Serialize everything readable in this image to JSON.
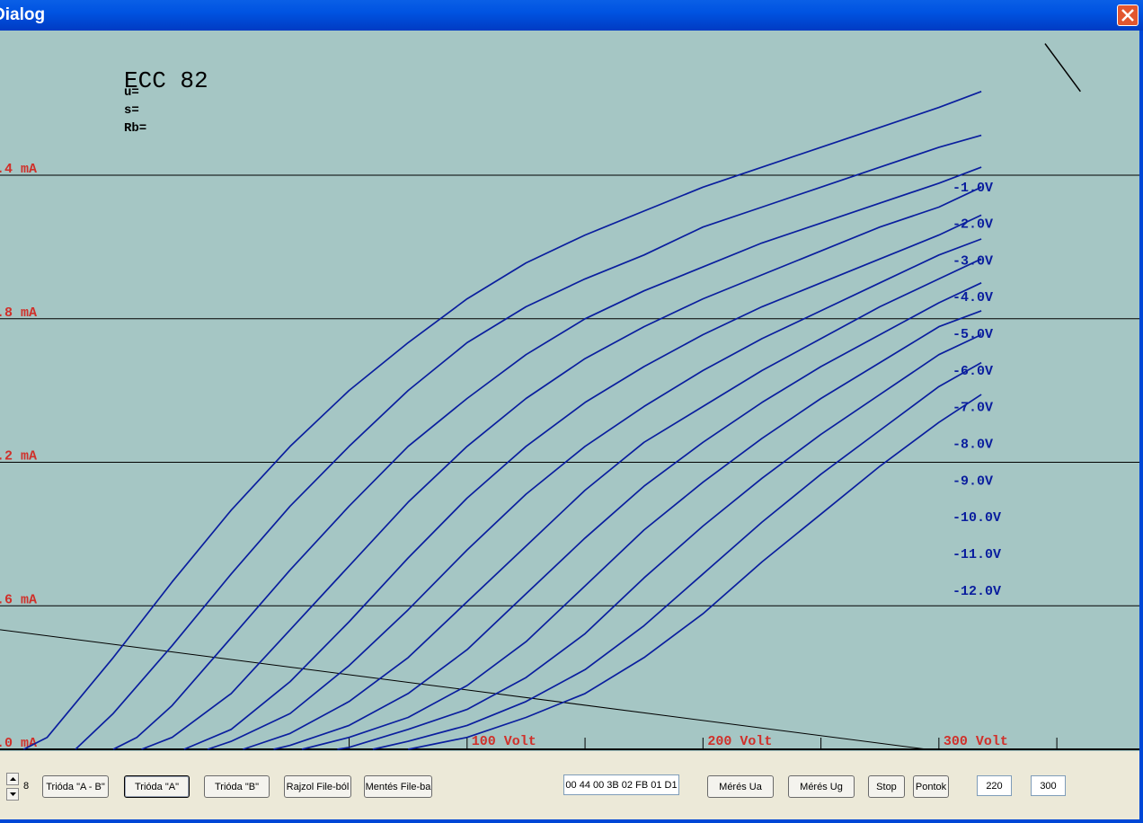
{
  "window": {
    "title": "Dialog",
    "close_icon": "close-icon",
    "accent": "#0053E1",
    "close_color": "#E2562F"
  },
  "plot": {
    "tube_name": "ECC 82",
    "params": [
      "u=",
      "s=",
      "Rb="
    ],
    "background": "#A5C6C4",
    "curve_color": "#0A1E9E",
    "axis_label_color": "#D0302A"
  },
  "chart_data": {
    "type": "line",
    "xlim": [
      -98,
      385
    ],
    "ylim": [
      0,
      14.4
    ],
    "x_tick_labels": [
      "100 Volt",
      "200 Volt",
      "300 Volt"
    ],
    "x_ticks": [
      50,
      100,
      150,
      200,
      250,
      300,
      350
    ],
    "y_tick_labels": [
      ".0 mA",
      ".6 mA",
      ".2 mA",
      ".8 mA",
      ".4 mA"
    ],
    "y_gridlines": [
      3.6,
      7.2,
      10.8,
      14.4
    ],
    "load_line": {
      "x": [
        -98,
        295
      ],
      "y": [
        3.0,
        0
      ]
    },
    "annotation_line": {
      "x": [
        345,
        360
      ],
      "y": [
        17.7,
        16.5
      ]
    },
    "series_labels": [
      "-1.0V",
      "-2.0V",
      "-3.0V",
      "-4.0V",
      "-5.0V",
      "-6.0V",
      "-7.0V",
      "-8.0V",
      "-9.0V",
      "-10.0V",
      "-11.0V",
      "-12.0V"
    ],
    "series": [
      {
        "name": "-1.0V",
        "x": [
          -88,
          -78,
          -50,
          -25,
          0,
          25,
          50,
          75,
          100,
          125,
          150,
          175,
          200,
          225,
          250,
          275,
          300,
          318
        ],
        "y": [
          0,
          0.3,
          2.3,
          4.2,
          6.0,
          7.6,
          9.0,
          10.2,
          11.3,
          12.2,
          12.9,
          13.5,
          14.1,
          14.6,
          15.1,
          15.6,
          16.1,
          16.5
        ]
      },
      {
        "name": "-2.0V",
        "x": [
          -66,
          -50,
          -25,
          0,
          25,
          50,
          75,
          100,
          125,
          150,
          175,
          200,
          225,
          250,
          275,
          300,
          318
        ],
        "y": [
          0,
          0.9,
          2.6,
          4.4,
          6.1,
          7.6,
          9.0,
          10.2,
          11.1,
          11.8,
          12.4,
          13.1,
          13.6,
          14.1,
          14.6,
          15.1,
          15.4
        ]
      },
      {
        "name": "-3.0V",
        "x": [
          -50,
          -40,
          -25,
          0,
          25,
          50,
          75,
          100,
          125,
          150,
          175,
          200,
          225,
          250,
          275,
          300,
          318
        ],
        "y": [
          0,
          0.3,
          1.1,
          2.8,
          4.5,
          6.1,
          7.6,
          8.8,
          9.9,
          10.8,
          11.5,
          12.1,
          12.7,
          13.2,
          13.7,
          14.2,
          14.6
        ]
      },
      {
        "name": "-4.0V",
        "x": [
          -38,
          -25,
          0,
          25,
          50,
          75,
          100,
          125,
          150,
          175,
          200,
          225,
          250,
          275,
          300,
          318
        ],
        "y": [
          0,
          0.3,
          1.4,
          3.0,
          4.6,
          6.2,
          7.6,
          8.8,
          9.8,
          10.6,
          11.3,
          11.9,
          12.5,
          13.1,
          13.6,
          14.1
        ]
      },
      {
        "name": "-5.0V",
        "x": [
          -20,
          0,
          25,
          50,
          75,
          100,
          125,
          150,
          175,
          200,
          225,
          250,
          275,
          300,
          318
        ],
        "y": [
          0,
          0.5,
          1.7,
          3.2,
          4.8,
          6.3,
          7.6,
          8.7,
          9.6,
          10.4,
          11.1,
          11.7,
          12.3,
          12.9,
          13.4
        ]
      },
      {
        "name": "-6.0V",
        "x": [
          -10,
          0,
          25,
          50,
          75,
          100,
          125,
          150,
          175,
          200,
          225,
          250,
          275,
          300,
          318
        ],
        "y": [
          0,
          0.2,
          0.9,
          2.1,
          3.5,
          5.0,
          6.4,
          7.6,
          8.6,
          9.5,
          10.3,
          11.0,
          11.7,
          12.4,
          12.8
        ]
      },
      {
        "name": "-7.0V",
        "x": [
          5,
          25,
          50,
          75,
          100,
          125,
          150,
          175,
          200,
          225,
          250,
          275,
          300,
          318
        ],
        "y": [
          0,
          0.4,
          1.2,
          2.3,
          3.7,
          5.1,
          6.5,
          7.7,
          8.6,
          9.5,
          10.3,
          11.1,
          11.8,
          12.3
        ]
      },
      {
        "name": "-8.0V",
        "x": [
          18,
          25,
          50,
          75,
          100,
          125,
          150,
          175,
          200,
          225,
          250,
          275,
          300,
          318
        ],
        "y": [
          0,
          0.1,
          0.6,
          1.4,
          2.5,
          3.9,
          5.3,
          6.6,
          7.7,
          8.7,
          9.6,
          10.4,
          11.2,
          11.7
        ]
      },
      {
        "name": "-9.0V",
        "x": [
          30,
          50,
          75,
          100,
          125,
          150,
          175,
          200,
          225,
          250,
          275,
          300,
          318
        ],
        "y": [
          0,
          0.3,
          0.8,
          1.6,
          2.7,
          4.1,
          5.5,
          6.7,
          7.8,
          8.8,
          9.7,
          10.6,
          11.0
        ]
      },
      {
        "name": "-10.0V",
        "x": [
          45,
          50,
          75,
          100,
          125,
          150,
          175,
          200,
          225,
          250,
          275,
          300,
          318
        ],
        "y": [
          0,
          0.05,
          0.5,
          1.0,
          1.8,
          2.9,
          4.3,
          5.6,
          6.8,
          7.9,
          8.9,
          9.9,
          10.4
        ]
      },
      {
        "name": "-11.0V",
        "x": [
          60,
          75,
          100,
          125,
          150,
          175,
          200,
          225,
          250,
          275,
          300,
          318
        ],
        "y": [
          0,
          0.2,
          0.6,
          1.2,
          2.0,
          3.1,
          4.4,
          5.7,
          6.9,
          8.0,
          9.1,
          9.7
        ]
      },
      {
        "name": "-12.0V",
        "x": [
          75,
          100,
          125,
          150,
          175,
          200,
          225,
          250,
          275,
          300,
          318
        ],
        "y": [
          0,
          0.3,
          0.8,
          1.4,
          2.3,
          3.4,
          4.7,
          5.9,
          7.1,
          8.2,
          8.9
        ]
      }
    ]
  },
  "controls": {
    "spin_value": "8",
    "buttons": [
      "Trióda \"A - B\"",
      "Trióda  \"A\"",
      "Trióda  \"B\"",
      "Rajzol File-ból",
      "Mentés File-ba",
      "Mérés Ua",
      "Mérés Ug",
      "Stop",
      "Pontok"
    ],
    "hex_field": "00 44 00 3B 02 FB 01 D1",
    "field_1": "220",
    "field_2": "300"
  }
}
